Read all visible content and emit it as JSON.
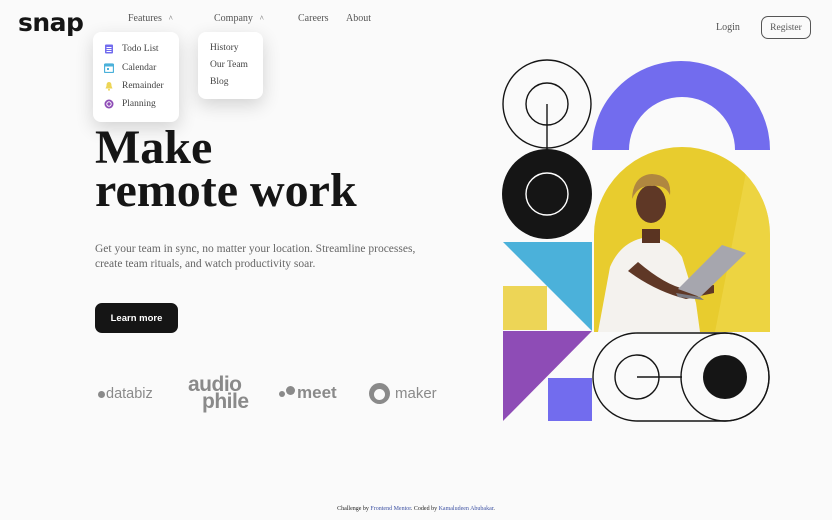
{
  "brand": {
    "logo": "snap"
  },
  "nav": {
    "features": "Features",
    "company": "Company",
    "careers": "Careers",
    "about": "About"
  },
  "features_menu": [
    {
      "label": "Todo List",
      "icon": "todo-list-icon",
      "color": "#726CEE"
    },
    {
      "label": "Calendar",
      "icon": "calendar-icon",
      "color": "#4BB1DA"
    },
    {
      "label": "Remainder",
      "icon": "bell-icon",
      "color": "#EDD556"
    },
    {
      "label": "Planning",
      "icon": "planning-icon",
      "color": "#8E4CB6"
    }
  ],
  "company_menu": [
    {
      "label": "History"
    },
    {
      "label": "Our Team"
    },
    {
      "label": "Blog"
    }
  ],
  "auth": {
    "login": "Login",
    "register": "Register"
  },
  "hero": {
    "headline_line1": "Make",
    "headline_line2": "remote work",
    "subtext": "Get your team in sync, no matter your location. Streamline processes, create team rituals, and watch productivity soar.",
    "cta": "Learn more"
  },
  "clients": {
    "databiz": "databiz",
    "audiophile_top": "audio",
    "audiophile_bottom": "phile",
    "meet": "meet",
    "maker": "maker"
  },
  "footer": {
    "prefix": "Challenge by",
    "fm_link": "Frontend Mentor",
    "middle": ". Coded by",
    "author_link": "Kamaludeen Abubakar",
    "suffix": "."
  },
  "colors": {
    "dark": "#151515",
    "purple": "#726CEE",
    "blue": "#4BB1DA",
    "yellow": "#EDD556",
    "violet": "#8E4CB6",
    "photo_bg": "#E8CC2E"
  }
}
